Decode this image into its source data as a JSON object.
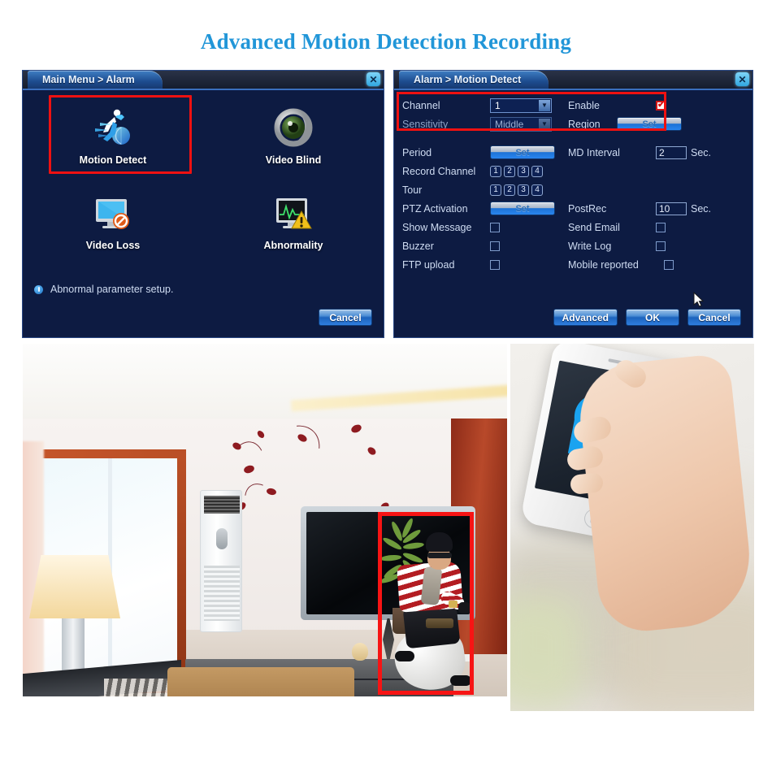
{
  "banner": {
    "title": "Advanced Motion Detection Recording",
    "color": "#2196d8"
  },
  "alarm_dialog": {
    "title": "Main Menu > Alarm",
    "close_label": "✕",
    "items": [
      {
        "label": "Motion Detect",
        "icon": "running-man-icon",
        "selected": true
      },
      {
        "label": "Video Blind",
        "icon": "eye-icon",
        "selected": false
      },
      {
        "label": "Video Loss",
        "icon": "monitor-blocked-icon",
        "selected": false
      },
      {
        "label": "Abnormality",
        "icon": "monitor-warning-icon",
        "selected": false
      }
    ],
    "hint": "Abnormal parameter setup.",
    "hint_icon": "info-icon",
    "cancel_label": "Cancel",
    "highlight_color": "#ee1111"
  },
  "motion_dialog": {
    "title": "Alarm > Motion Detect",
    "close_label": "✕",
    "highlight_color": "#ee1111",
    "channel": {
      "label": "Channel",
      "value": "1"
    },
    "enable": {
      "label": "Enable",
      "checked": true
    },
    "sensitivity": {
      "label": "Sensitivity",
      "value": "Middle"
    },
    "region": {
      "label": "Region",
      "button": "Set"
    },
    "period": {
      "label": "Period",
      "button": "Set"
    },
    "md_interval": {
      "label": "MD Interval",
      "value": "2",
      "unit": "Sec."
    },
    "record_channel": {
      "label": "Record Channel",
      "channels": [
        "1",
        "2",
        "3",
        "4"
      ]
    },
    "tour": {
      "label": "Tour",
      "channels": [
        "1",
        "2",
        "3",
        "4"
      ]
    },
    "ptz_activation": {
      "label": "PTZ Activation",
      "button": "Set"
    },
    "post_rec": {
      "label": "PostRec",
      "value": "10",
      "unit": "Sec."
    },
    "show_message": {
      "label": "Show Message",
      "checked": false
    },
    "send_email": {
      "label": "Send Email",
      "checked": false
    },
    "buzzer": {
      "label": "Buzzer",
      "checked": false
    },
    "write_log": {
      "label": "Write Log",
      "checked": false
    },
    "ftp_upload": {
      "label": "FTP upload",
      "checked": false
    },
    "mobile_reported": {
      "label": "Mobile reported",
      "checked": false
    },
    "advanced_label": "Advanced",
    "ok_label": "OK",
    "cancel_label": "Cancel"
  },
  "photos": {
    "room": {
      "name": "living-room-surveillance-photo",
      "detection_box_color": "#f71414"
    },
    "phone": {
      "name": "hand-holding-phone-photo"
    }
  }
}
